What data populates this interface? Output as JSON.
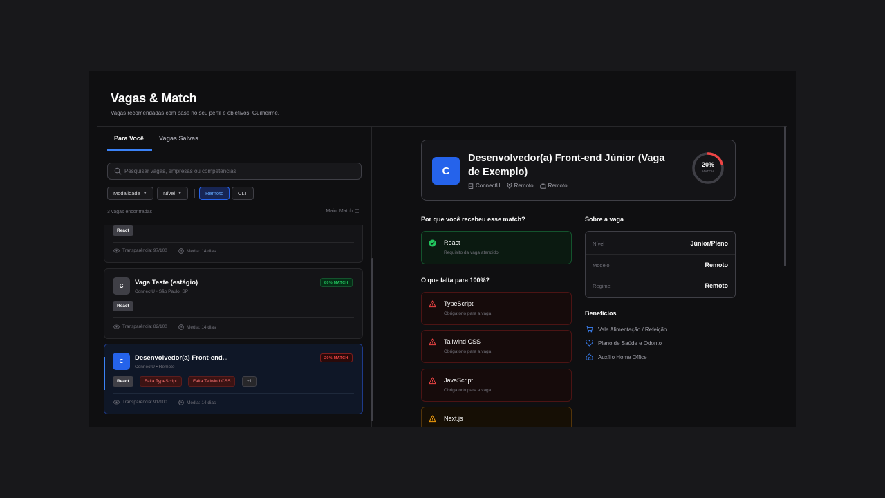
{
  "header": {
    "title": "Vagas & Match",
    "subtitle": "Vagas recomendadas com base no seu perfil e objetivos, Guilherme."
  },
  "tabs": [
    {
      "label": "Para Você",
      "active": true
    },
    {
      "label": "Vagas Salvas",
      "active": false
    }
  ],
  "search": {
    "placeholder": "Pesquisar vagas, empresas ou competências",
    "value": ""
  },
  "filters": {
    "modalidade": "Modalidade",
    "nivel": "Nível",
    "active_chips": [
      "Remoto",
      "CLT"
    ]
  },
  "results": {
    "count_text": "3 vagas encontradas",
    "sort_label": "Maior Match"
  },
  "job_list": [
    {
      "tags": [
        "React"
      ],
      "transparency": "Transparência: 97/100",
      "average": "Média: 14 dias"
    },
    {
      "logo": "C",
      "title": "Vaga Teste (estágio)",
      "meta": "ConnectU • São Paulo, SP",
      "match": "80% MATCH",
      "tags": [
        "React"
      ],
      "transparency": "Transparência: 82/100",
      "average": "Média: 14 dias"
    },
    {
      "logo": "C",
      "title": "Desenvolvedor(a) Front-end...",
      "meta": "ConnectU • Remoto",
      "match": "20% MATCH",
      "tags": [
        "React"
      ],
      "missing_tags": [
        "Falta TypeScript",
        "Falta Tailwind CSS"
      ],
      "more": "+1",
      "transparency": "Transparência: 91/100",
      "average": "Média: 14 dias",
      "selected": true
    }
  ],
  "detail": {
    "logo": "C",
    "title": "Desenvolvedor(a) Front-end Júnior (Vaga de Exemplo)",
    "company": "ConnectU",
    "location": "Remoto",
    "modality": "Remoto",
    "match_percent": 20,
    "match_percent_text": "20%",
    "match_label": "MATCH",
    "why_title": "Por que você recebeu esse match?",
    "met": [
      {
        "name": "React",
        "sub": "Requisito da vaga atendido."
      }
    ],
    "missing_title": "O que falta para 100%?",
    "missing": [
      {
        "name": "TypeScript",
        "sub": "Obrigatório para a vaga"
      },
      {
        "name": "Tailwind CSS",
        "sub": "Obrigatório para a vaga"
      },
      {
        "name": "JavaScript",
        "sub": "Obrigatório para a vaga"
      },
      {
        "name": "Next.js",
        "sub": ""
      }
    ],
    "about_title": "Sobre a vaga",
    "about": [
      {
        "label": "Nível",
        "value": "Júnior/Pleno"
      },
      {
        "label": "Modelo",
        "value": "Remoto"
      },
      {
        "label": "Regime",
        "value": "Remoto"
      }
    ],
    "benefits_title": "Benefícios",
    "benefits": [
      {
        "icon": "cart-icon",
        "label": "Vale Alimentação / Refeição"
      },
      {
        "icon": "heart-icon",
        "label": "Plano de Saúde e Odonto"
      },
      {
        "icon": "home-icon",
        "label": "Auxílio Home Office"
      }
    ]
  },
  "colors": {
    "accent": "#3b82f6",
    "match_green": "#22c55e",
    "match_red": "#ef4444",
    "warning": "#f59e0b",
    "background": "#0f0f11"
  }
}
